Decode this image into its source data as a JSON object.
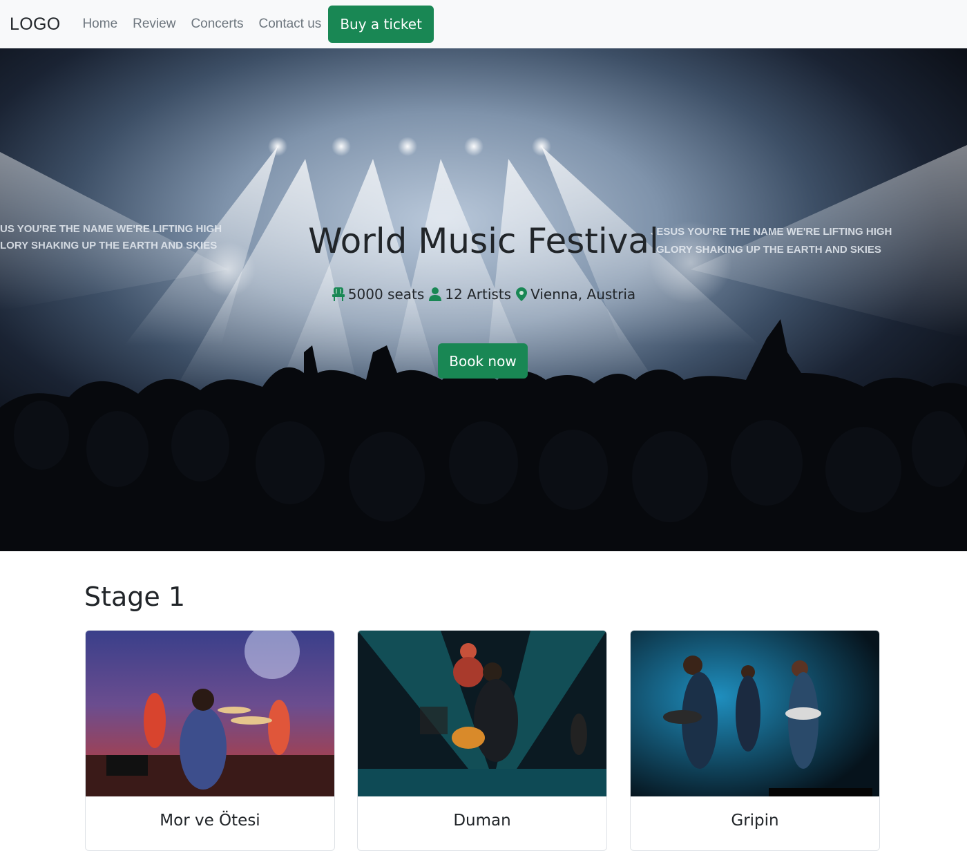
{
  "nav": {
    "logo": "LOGO",
    "links": [
      "Home",
      "Review",
      "Concerts",
      "Contact us"
    ],
    "cta": "Buy a ticket"
  },
  "hero": {
    "title": "World Music Festival",
    "seats": "5000 seats",
    "artists": "12 Artists",
    "location": "Vienna, Austria",
    "button": "Book now",
    "screen_text_left": "US YOU'RE THE NAME WE'RE LIFTING HIGH  LORY SHAKING UP THE EARTH AND SKIES",
    "screen_text_right": "JESUS YOU'RE THE NAME WE'RE LIFTING HIGH  GLORY SHAKING UP THE EARTH AND SKIES"
  },
  "stage": {
    "title": "Stage 1",
    "cards": [
      {
        "name": "Mor ve Ötesi"
      },
      {
        "name": "Duman"
      },
      {
        "name": "Gripin"
      }
    ]
  },
  "colors": {
    "accent": "#198754",
    "navbar_bg": "#f8f9fa",
    "text": "#212529",
    "muted": "#6c757d"
  },
  "icons": [
    "chair-icon",
    "person-icon",
    "location-pin-icon"
  ]
}
